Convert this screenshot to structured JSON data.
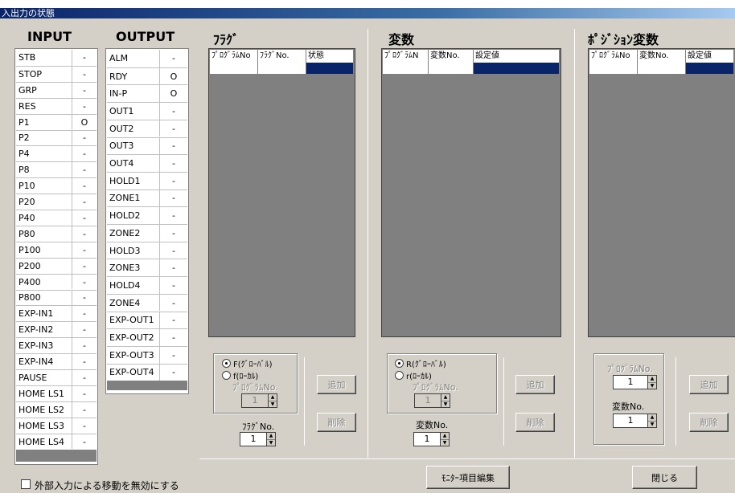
{
  "window": {
    "title": "入出力の状態"
  },
  "input": {
    "title": "INPUT",
    "rows": [
      {
        "name": "STB",
        "value": "-"
      },
      {
        "name": "STOP",
        "value": "-"
      },
      {
        "name": "GRP",
        "value": "-"
      },
      {
        "name": "RES",
        "value": "-"
      },
      {
        "name": "P1",
        "value": "O"
      },
      {
        "name": "P2",
        "value": "-"
      },
      {
        "name": "P4",
        "value": "-"
      },
      {
        "name": "P8",
        "value": "-"
      },
      {
        "name": "P10",
        "value": "-"
      },
      {
        "name": "P20",
        "value": "-"
      },
      {
        "name": "P40",
        "value": "-"
      },
      {
        "name": "P80",
        "value": "-"
      },
      {
        "name": "P100",
        "value": "-"
      },
      {
        "name": "P200",
        "value": "-"
      },
      {
        "name": "P400",
        "value": "-"
      },
      {
        "name": "P800",
        "value": "-"
      },
      {
        "name": "EXP-IN1",
        "value": "-"
      },
      {
        "name": "EXP-IN2",
        "value": "-"
      },
      {
        "name": "EXP-IN3",
        "value": "-"
      },
      {
        "name": "EXP-IN4",
        "value": "-"
      },
      {
        "name": "PAUSE",
        "value": "-"
      },
      {
        "name": "HOME LS1",
        "value": "-"
      },
      {
        "name": "HOME LS2",
        "value": "-"
      },
      {
        "name": "HOME LS3",
        "value": "-"
      },
      {
        "name": "HOME LS4",
        "value": "-"
      }
    ]
  },
  "output": {
    "title": "OUTPUT",
    "rows": [
      {
        "name": "ALM",
        "value": "-"
      },
      {
        "name": "RDY",
        "value": "O"
      },
      {
        "name": "IN-P",
        "value": "O"
      },
      {
        "name": "OUT1",
        "value": "-"
      },
      {
        "name": "OUT2",
        "value": "-"
      },
      {
        "name": "OUT3",
        "value": "-"
      },
      {
        "name": "OUT4",
        "value": "-"
      },
      {
        "name": "HOLD1",
        "value": "-"
      },
      {
        "name": "ZONE1",
        "value": "-"
      },
      {
        "name": "HOLD2",
        "value": "-"
      },
      {
        "name": "ZONE2",
        "value": "-"
      },
      {
        "name": "HOLD3",
        "value": "-"
      },
      {
        "name": "ZONE3",
        "value": "-"
      },
      {
        "name": "HOLD4",
        "value": "-"
      },
      {
        "name": "ZONE4",
        "value": "-"
      },
      {
        "name": "EXP-OUT1",
        "value": "-"
      },
      {
        "name": "EXP-OUT2",
        "value": "-"
      },
      {
        "name": "EXP-OUT3",
        "value": "-"
      },
      {
        "name": "EXP-OUT4",
        "value": "-"
      }
    ]
  },
  "flag": {
    "title": "ﾌﾗｸﾞ",
    "columns": [
      "ﾌﾟﾛｸﾞﾗﾑNo",
      "ﾌﾗｸﾞNo.",
      "状態"
    ],
    "radio_global": "F(ｸﾞﾛｰﾊﾞﾙ)",
    "radio_local": "f(ﾛｰｶﾙ)",
    "program_no_label": "ﾌﾟﾛｸﾞﾗﾑNo.",
    "program_no_value": "1",
    "number_label": "ﾌﾗｸﾞNo.",
    "number_value": "1",
    "add_label": "追加",
    "delete_label": "削除"
  },
  "variable": {
    "title": "変数",
    "columns": [
      "ﾌﾟﾛｸﾞﾗﾑN",
      "変数No.",
      "設定値"
    ],
    "radio_global": "R(ｸﾞﾛｰﾊﾞﾙ)",
    "radio_local": "r(ﾛｰｶﾙ)",
    "program_no_label": "ﾌﾟﾛｸﾞﾗﾑNo.",
    "program_no_value": "1",
    "number_label": "変数No.",
    "number_value": "1",
    "add_label": "追加",
    "delete_label": "削除"
  },
  "position": {
    "title": "ﾎﾟｼﾞｼｮﾝ変数",
    "columns": [
      "ﾌﾟﾛｸﾞﾗﾑNo",
      "変数No.",
      "設定値"
    ],
    "program_no_label": "ﾌﾟﾛｸﾞﾗﾑNo.",
    "program_no_value": "1",
    "number_label": "変数No.",
    "number_value": "1",
    "add_label": "追加",
    "delete_label": "削除"
  },
  "footer": {
    "checkbox_label": "外部入力による移動を無効にする",
    "monitor_button": "ﾓﾆﾀｰ項目編集",
    "close_button": "閉じる"
  }
}
